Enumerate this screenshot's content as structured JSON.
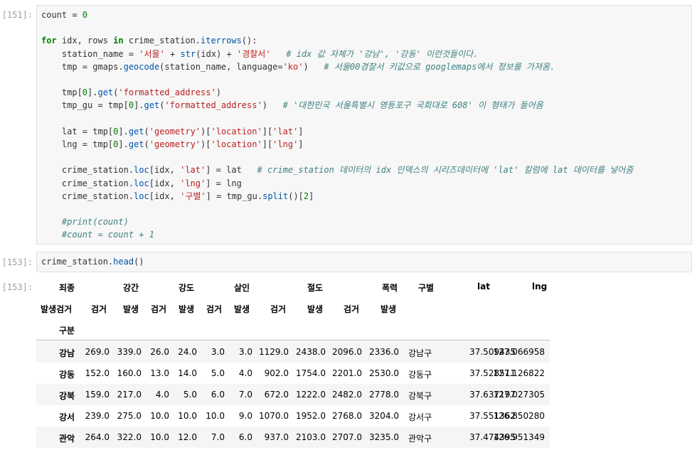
{
  "cells": [
    {
      "prompt": "[151]:",
      "lines": [
        [
          [
            "count = ",
            ""
          ],
          [
            "0",
            "num"
          ]
        ],
        [],
        [
          [
            "for",
            "kw"
          ],
          [
            " idx, rows ",
            ""
          ],
          [
            "in",
            "kw"
          ],
          [
            " crime_station.",
            ""
          ],
          [
            "iterrows",
            "fn"
          ],
          [
            "():",
            ""
          ]
        ],
        [
          [
            "    station_name = ",
            ""
          ],
          [
            "'서울'",
            "str"
          ],
          [
            " + ",
            ""
          ],
          [
            "str",
            "fn"
          ],
          [
            "(idx) + ",
            ""
          ],
          [
            "'경찰서'",
            "str"
          ],
          [
            "   ",
            ""
          ],
          [
            "# idx 값 자체가 '강남', '강동' 이런것들이다.",
            "cm"
          ]
        ],
        [
          [
            "    tmp = gmaps.",
            ""
          ],
          [
            "geocode",
            "fn"
          ],
          [
            "(station_name, language=",
            ""
          ],
          [
            "'ko'",
            "str"
          ],
          [
            ")   ",
            ""
          ],
          [
            "# 서울00경찰서 키값으로 googlemaps에서 정보를 가져옴.",
            "cm"
          ]
        ],
        [],
        [
          [
            "    tmp[",
            ""
          ],
          [
            "0",
            "num"
          ],
          [
            "].",
            ""
          ],
          [
            "get",
            "fn"
          ],
          [
            "(",
            ""
          ],
          [
            "'formatted_address'",
            "str"
          ],
          [
            ")",
            ""
          ]
        ],
        [
          [
            "    tmp_gu = tmp[",
            ""
          ],
          [
            "0",
            "num"
          ],
          [
            "].",
            ""
          ],
          [
            "get",
            "fn"
          ],
          [
            "(",
            ""
          ],
          [
            "'formatted_address'",
            "str"
          ],
          [
            ")   ",
            ""
          ],
          [
            "# '대한민국 서울특별시 영등포구 국회대로 608' 이 형태가 들어옴",
            "cm"
          ]
        ],
        [],
        [
          [
            "    lat = tmp[",
            ""
          ],
          [
            "0",
            "num"
          ],
          [
            "].",
            ""
          ],
          [
            "get",
            "fn"
          ],
          [
            "(",
            ""
          ],
          [
            "'geometry'",
            "str"
          ],
          [
            ")[",
            ""
          ],
          [
            "'location'",
            "str"
          ],
          [
            "][",
            ""
          ],
          [
            "'lat'",
            "str"
          ],
          [
            "]",
            ""
          ]
        ],
        [
          [
            "    lng = tmp[",
            ""
          ],
          [
            "0",
            "num"
          ],
          [
            "].",
            ""
          ],
          [
            "get",
            "fn"
          ],
          [
            "(",
            ""
          ],
          [
            "'geometry'",
            "str"
          ],
          [
            ")[",
            ""
          ],
          [
            "'location'",
            "str"
          ],
          [
            "][",
            ""
          ],
          [
            "'lng'",
            "str"
          ],
          [
            "]",
            ""
          ]
        ],
        [],
        [
          [
            "    crime_station.",
            ""
          ],
          [
            "loc",
            "fn"
          ],
          [
            "[idx, ",
            ""
          ],
          [
            "'lat'",
            "str"
          ],
          [
            "] = lat   ",
            ""
          ],
          [
            "# crime_station 데이터의 idx 인덱스의 시리즈데이터에 'lat' 칼럼에 lat 데이터를 넣어줌",
            "cm"
          ]
        ],
        [
          [
            "    crime_station.",
            ""
          ],
          [
            "loc",
            "fn"
          ],
          [
            "[idx, ",
            ""
          ],
          [
            "'lng'",
            "str"
          ],
          [
            "] = lng",
            ""
          ]
        ],
        [
          [
            "    crime_station.",
            ""
          ],
          [
            "loc",
            "fn"
          ],
          [
            "[idx, ",
            ""
          ],
          [
            "'구별'",
            "str"
          ],
          [
            "] = tmp_gu.",
            ""
          ],
          [
            "split",
            "fn"
          ],
          [
            "()[",
            ""
          ],
          [
            "2",
            "num"
          ],
          [
            "]",
            ""
          ]
        ],
        [],
        [
          [
            "    ",
            ""
          ],
          [
            "#print(count)",
            "cm"
          ]
        ],
        [
          [
            "    ",
            ""
          ],
          [
            "#count = count + 1",
            "cm"
          ]
        ]
      ]
    },
    {
      "prompt": "[153]:",
      "lines": [
        [
          [
            "crime_station.",
            ""
          ],
          [
            "head",
            "fn"
          ],
          [
            "()",
            ""
          ]
        ]
      ]
    }
  ],
  "output": {
    "prompt": "[153]:",
    "top_header": [
      "죄종",
      "강간",
      "강도",
      "살인",
      "절도",
      "폭력",
      "구별",
      "lat",
      "lng"
    ],
    "second_header": [
      "발생검거",
      "검거",
      "발생",
      "검거",
      "발생",
      "검거",
      "발생",
      "검거",
      "발생",
      "검거",
      "발생"
    ],
    "index_name": "구분",
    "rows": [
      [
        "강남",
        "269.0",
        "339.0",
        "26.0",
        "24.0",
        "3.0",
        "3.0",
        "1129.0",
        "2438.0",
        "2096.0",
        "2336.0",
        "강남구",
        "37.509435",
        "127.066958"
      ],
      [
        "강동",
        "152.0",
        "160.0",
        "13.0",
        "14.0",
        "5.0",
        "4.0",
        "902.0",
        "1754.0",
        "2201.0",
        "2530.0",
        "강동구",
        "37.528511",
        "127.126822"
      ],
      [
        "강북",
        "159.0",
        "217.0",
        "4.0",
        "5.0",
        "6.0",
        "7.0",
        "672.0",
        "1222.0",
        "2482.0",
        "2778.0",
        "강북구",
        "37.637197",
        "127.027305"
      ],
      [
        "강서",
        "239.0",
        "275.0",
        "10.0",
        "10.0",
        "10.0",
        "9.0",
        "1070.0",
        "1952.0",
        "2768.0",
        "3204.0",
        "강서구",
        "37.551362",
        "126.850280"
      ],
      [
        "관악",
        "264.0",
        "322.0",
        "10.0",
        "12.0",
        "7.0",
        "6.0",
        "937.0",
        "2103.0",
        "2707.0",
        "3235.0",
        "관악구",
        "37.474395",
        "126.951349"
      ]
    ]
  }
}
